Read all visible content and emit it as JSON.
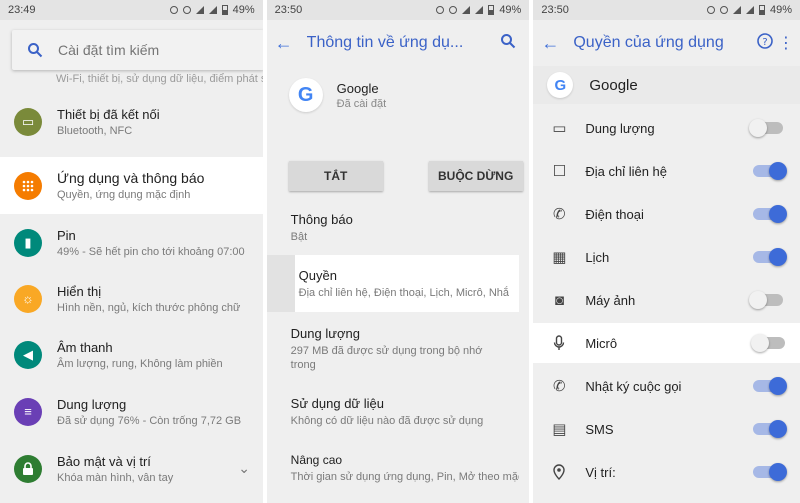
{
  "colors": {
    "accent": "#3b62c7",
    "toggle_on": "#3d6bd8",
    "orange": "#f57c00",
    "teal": "#00897b",
    "purple": "#6a3fb5",
    "lime": "#9e9d24",
    "amber": "#f9a825"
  },
  "panel1": {
    "status": {
      "time": "23:49",
      "battery": "49%"
    },
    "search_placeholder": "Cài đặt tìm kiếm",
    "cutoff_text": "Wi-Fi, thiết bị, sử dụng dữ liệu, điểm phát sóng",
    "items": [
      {
        "title": "Thiết bị đã kết nối",
        "subtitle": "Bluetooth, NFC",
        "icon": "devices-icon",
        "color": "#7a8a3a"
      },
      {
        "title": "Ứng dụng và thông báo",
        "subtitle": "Quyền, ứng dụng mặc định",
        "icon": "apps-icon",
        "color": "#f57c00"
      },
      {
        "title": "Pin",
        "subtitle": "49% - Sẽ hết pin cho tới khoảng 07:00",
        "icon": "battery-icon",
        "color": "#00897b"
      },
      {
        "title": "Hiển thị",
        "subtitle": "Hình nền, ngủ, kích thước phông chữ",
        "icon": "display-icon",
        "color": "#f9a825"
      },
      {
        "title": "Âm thanh",
        "subtitle": "Âm lượng, rung, Không làm phiền",
        "icon": "sound-icon",
        "color": "#00897b"
      },
      {
        "title": "Dung lượng",
        "subtitle": "Đã sử dụng 76% - Còn trống 7,72 GB",
        "icon": "storage-icon",
        "color": "#6a3fb5"
      },
      {
        "title": "Bảo mật và vị trí",
        "subtitle": "Khóa màn hình, vân tay",
        "icon": "lock-icon",
        "color": "#2e7d32"
      }
    ]
  },
  "panel2": {
    "status": {
      "time": "23:50",
      "battery": "49%"
    },
    "title": "Thông tin về ứng dụ...",
    "app_name": "Google",
    "app_status": "Đã cài đặt",
    "btn_disable": "TẮT",
    "btn_force_stop": "BUỘC DỪNG",
    "items": [
      {
        "title": "Thông báo",
        "subtitle": "Bật"
      },
      {
        "title": "Quyền",
        "subtitle": "Địa chỉ liên hệ, Điện thoại, Lịch, Micrô, Nhắ"
      },
      {
        "title": "Dung lượng",
        "subtitle": "297 MB đã được sử dụng trong bộ nhớ trong"
      },
      {
        "title": "Sử dụng dữ liệu",
        "subtitle": "Không có dữ liệu nào đã được sử dụng"
      },
      {
        "title": "Nâng cao",
        "subtitle": "Thời gian sử dụng ứng dụng, Pin, Mở theo mặc"
      }
    ]
  },
  "panel3": {
    "status": {
      "time": "23:50",
      "battery": "49%"
    },
    "title": "Quyền của ứng dụng",
    "app_name": "Google",
    "permissions": [
      {
        "label": "Dung lượng",
        "icon": "folder-icon",
        "on": false
      },
      {
        "label": "Địa chỉ liên hệ",
        "icon": "contacts-icon",
        "on": true
      },
      {
        "label": "Điện thoại",
        "icon": "phone-icon",
        "on": true
      },
      {
        "label": "Lịch",
        "icon": "calendar-icon",
        "on": true
      },
      {
        "label": "Máy ảnh",
        "icon": "camera-icon",
        "on": false
      },
      {
        "label": "Micrô",
        "icon": "microphone-icon",
        "on": false
      },
      {
        "label": "Nhật ký cuộc gọi",
        "icon": "call-log-icon",
        "on": true
      },
      {
        "label": "SMS",
        "icon": "sms-icon",
        "on": true
      },
      {
        "label": "Vị trí:",
        "icon": "location-icon",
        "on": true
      }
    ]
  }
}
